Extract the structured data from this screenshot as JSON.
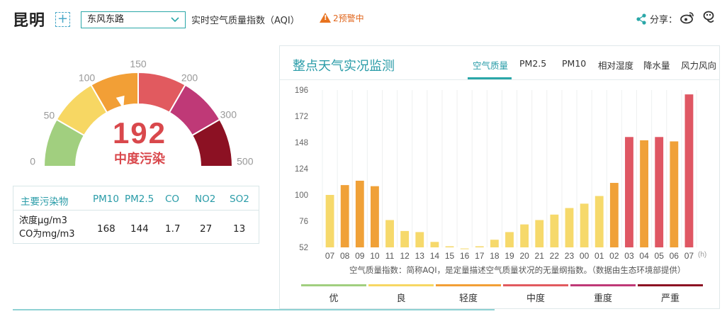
{
  "header": {
    "city": "昆明",
    "add_label": "+",
    "station": "东风东路",
    "aqi_title": "实时空气质量指数（AQI）",
    "warning_count": "2预警中",
    "share_label": "分享："
  },
  "gauge": {
    "value": "192",
    "level": "中度污染",
    "scale_labels": [
      "0",
      "50",
      "100",
      "150",
      "200",
      "300",
      "500"
    ],
    "segment_colors": [
      "#a1cf7f",
      "#f7d763",
      "#f29f36",
      "#e15a5f",
      "#bf3977",
      "#8c1123"
    ],
    "needle_fraction": 0.42
  },
  "pollutants": {
    "header_label": "主要污染物",
    "unit_line1": "浓度μg/m3",
    "unit_line2": "CO为mg/m3",
    "items": [
      {
        "name": "PM10",
        "value": "168"
      },
      {
        "name": "PM2.5",
        "value": "144"
      },
      {
        "name": "CO",
        "value": "1.7"
      },
      {
        "name": "NO2",
        "value": "27"
      },
      {
        "name": "SO2",
        "value": "13"
      }
    ]
  },
  "panel": {
    "title": "整点天气实况监测",
    "tabs": [
      {
        "label": "空气质量",
        "active": true
      },
      {
        "label": "PM2.5",
        "active": false
      },
      {
        "label": "PM10",
        "active": false
      },
      {
        "label": "相对湿度",
        "active": false
      },
      {
        "label": "降水量",
        "active": false
      },
      {
        "label": "风力风向",
        "active": false
      }
    ],
    "note": "空气质量指数：简称AQI，是定量描述空气质量状况的无量纲指数。（数据由生态环境部提供）"
  },
  "chart_data": {
    "type": "bar",
    "categories": [
      "07",
      "08",
      "09",
      "10",
      "11",
      "12",
      "13",
      "14",
      "15",
      "16",
      "17",
      "18",
      "19",
      "20",
      "21",
      "22",
      "23",
      "00",
      "01",
      "02",
      "03",
      "04",
      "05",
      "06",
      "07"
    ],
    "values": [
      100,
      109,
      113,
      108,
      77,
      67,
      66,
      57,
      53,
      51,
      53,
      59,
      66,
      73,
      77,
      82,
      88,
      92,
      99,
      111,
      153,
      150,
      153,
      149,
      192
    ],
    "xlabel_unit": "(h)",
    "yticks": [
      52,
      76,
      100,
      124,
      148,
      172,
      196
    ],
    "ylim": [
      52,
      196
    ],
    "grid": "vertical",
    "colors": {
      "good": "#f6d96b",
      "light": "#f0a138",
      "moderate": "#df5763"
    }
  },
  "legend": [
    {
      "label": "优",
      "color": "#a1cf7f"
    },
    {
      "label": "良",
      "color": "#f7d763"
    },
    {
      "label": "轻度",
      "color": "#f29f36"
    },
    {
      "label": "中度",
      "color": "#e15a5f"
    },
    {
      "label": "重度",
      "color": "#bf3977"
    },
    {
      "label": "严重",
      "color": "#8c1123"
    }
  ]
}
